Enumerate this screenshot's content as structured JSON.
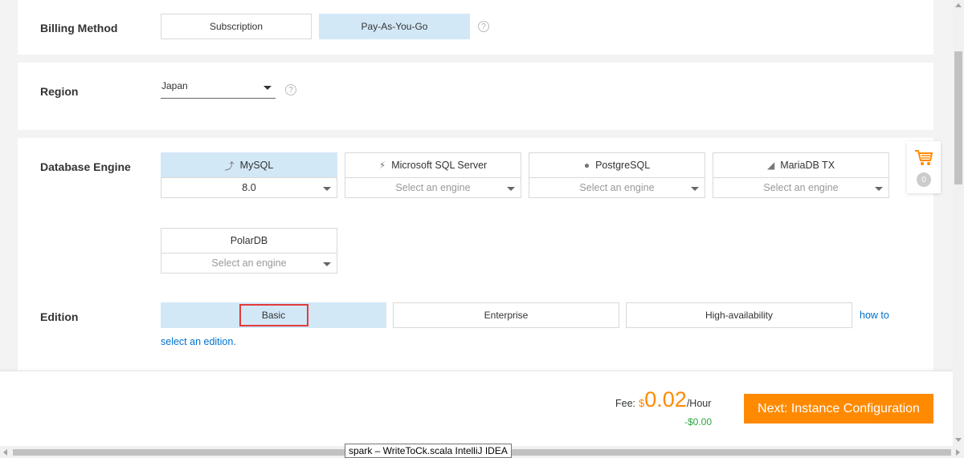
{
  "billing": {
    "label": "Billing Method",
    "options": [
      "Subscription",
      "Pay-As-You-Go"
    ],
    "selected": "Pay-As-You-Go"
  },
  "region": {
    "label": "Region",
    "value": "Japan"
  },
  "engine": {
    "label": "Database Engine",
    "items": [
      {
        "name": "MySQL",
        "version": "8.0",
        "icon": "dolphin-icon"
      },
      {
        "name": "Microsoft SQL Server",
        "version": "Select an engine",
        "icon": "sql-server-icon"
      },
      {
        "name": "PostgreSQL",
        "version": "Select an engine",
        "icon": "elephant-icon"
      },
      {
        "name": "MariaDB TX",
        "version": "Select an engine",
        "icon": "seal-icon"
      },
      {
        "name": "PolarDB",
        "version": "Select an engine",
        "icon": ""
      }
    ],
    "selected": "MySQL"
  },
  "edition": {
    "label": "Edition",
    "options": [
      "Basic",
      "Enterprise",
      "High-availability"
    ],
    "selected": "Basic",
    "link_part1": "how to",
    "link_part2": "select an edition."
  },
  "cart": {
    "count": "0",
    "icon": "shopping-cart-icon"
  },
  "footer": {
    "fee_label": "Fee:",
    "currency": "$",
    "amount": "0.02",
    "unit": "/Hour",
    "discount": "-$0.00",
    "next_button": "Next: Instance Configuration"
  },
  "taskbar_tooltip": "spark – WriteToCk.scala IntelliJ IDEA",
  "colors": {
    "selected_bg": "#d3e8f7",
    "accent_orange": "#ff8a00",
    "link_blue": "#0070cc",
    "discount_green": "#2da641"
  }
}
